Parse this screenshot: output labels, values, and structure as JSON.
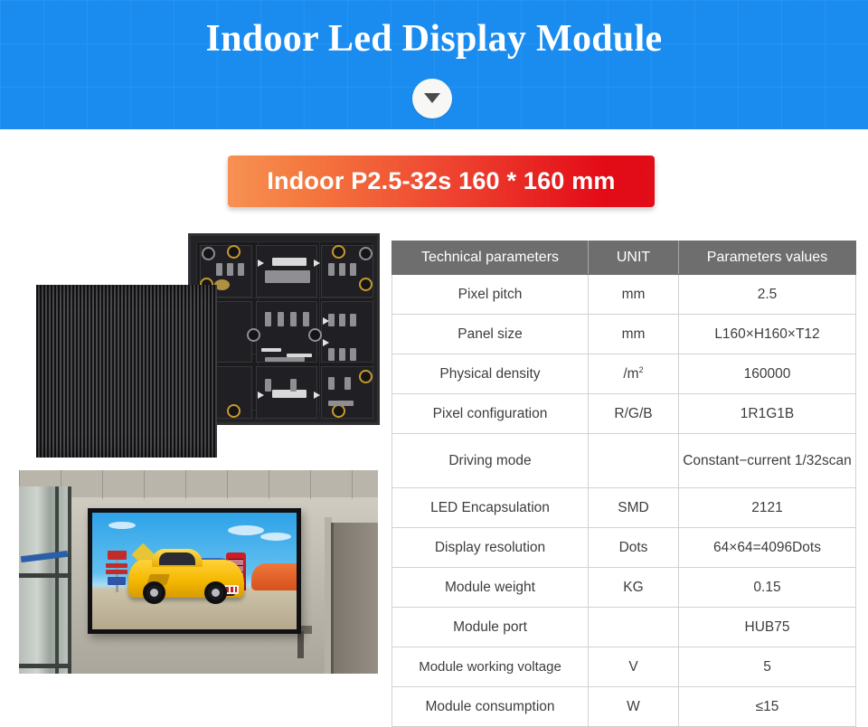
{
  "header": {
    "title": "Indoor Led Display Module",
    "scroll_icon": "chevron-down-icon"
  },
  "product_bar": {
    "label": "Indoor P2.5-32s  160 * 160 mm",
    "gradient_start": "#f79153",
    "gradient_end": "#e10d18"
  },
  "photos": [
    {
      "name": "led-module-photo",
      "caption": "Indoor LED display module front panel and PCB back"
    },
    {
      "name": "led-wall-installation-photo",
      "caption": "Indoor LED video wall installed in office showing yellow sports car"
    }
  ],
  "spec_table": {
    "header_bg": "#6e6e6e",
    "columns": [
      "Technical parameters",
      "UNIT",
      "Parameters values"
    ],
    "rows": [
      {
        "parameter": "Pixel pitch",
        "unit": "mm",
        "value": "2.5"
      },
      {
        "parameter": "Panel size",
        "unit": "mm",
        "value": "L160×H160×T12"
      },
      {
        "parameter": "Physical density",
        "unit": "/m2",
        "value": "160000"
      },
      {
        "parameter": "Pixel configuration",
        "unit": "R/G/B",
        "value": "1R1G1B"
      },
      {
        "parameter": "Driving mode",
        "unit": "",
        "value": "Constant−current 1/32scan"
      },
      {
        "parameter": "LED Encapsulation",
        "unit": "SMD",
        "value": "2121"
      },
      {
        "parameter": "Display resolution",
        "unit": "Dots",
        "value": "64×64=4096Dots"
      },
      {
        "parameter": "Module weight",
        "unit": "KG",
        "value": "0.15"
      },
      {
        "parameter": "Module port",
        "unit": "",
        "value": "HUB75"
      },
      {
        "parameter": "Module working voltage",
        "unit": "V",
        "value": "5"
      },
      {
        "parameter": "Module consumption",
        "unit": "W",
        "value": "≤15"
      }
    ]
  }
}
